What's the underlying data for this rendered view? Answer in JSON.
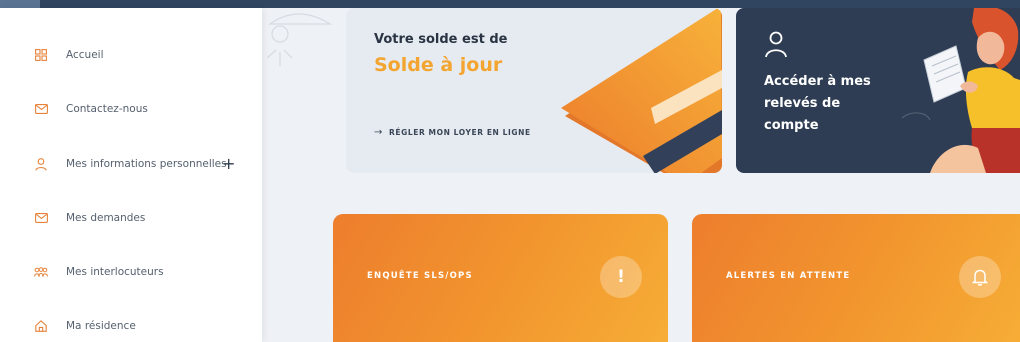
{
  "sidebar": {
    "items": [
      {
        "label": "Accueil",
        "icon": "grid-icon"
      },
      {
        "label": "Contactez-nous",
        "icon": "mail-icon"
      },
      {
        "label": "Mes informations personnelles",
        "icon": "user-icon",
        "expand": "+"
      },
      {
        "label": "Mes demandes",
        "icon": "mail-icon"
      },
      {
        "label": "Mes interlocuteurs",
        "icon": "people-icon"
      },
      {
        "label": "Ma résidence",
        "icon": "home-icon"
      }
    ]
  },
  "balance": {
    "title": "Votre solde est de",
    "value": "Solde à jour",
    "pay_arrow": "→",
    "pay_link": "RÉGLER MON LOYER EN LIGNE"
  },
  "statements": {
    "label": "Accéder à mes relevés de compte",
    "icon": "user-icon"
  },
  "tiles": {
    "survey_label": "ENQUÊTE SLS/OPS",
    "survey_badge": "!",
    "alerts_label": "ALERTES EN ATTENTE",
    "alerts_icon": "bell-icon"
  },
  "colors": {
    "accent": "#f3a530",
    "sidebar_icon": "#e8823a",
    "dark_card": "#2e3d54",
    "tile_start": "#ed7e2d",
    "tile_end": "#f6ad36"
  }
}
